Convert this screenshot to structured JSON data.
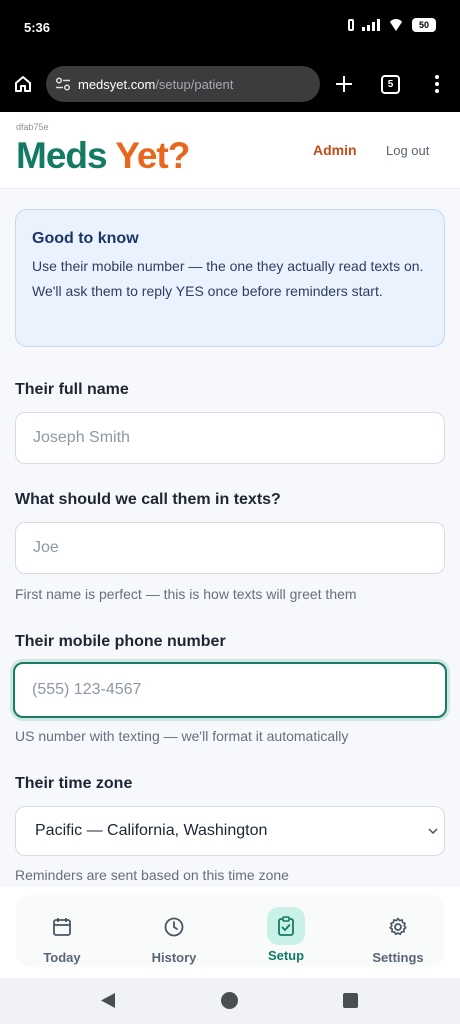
{
  "status_bar": {
    "time": "5:36",
    "battery": "50"
  },
  "browser": {
    "url_host": "medsyet.com",
    "url_path": "/setup/patient",
    "tab_count": "5"
  },
  "header": {
    "build_id": "dfab75e",
    "logo_part1": "Meds ",
    "logo_part2": "Yet?",
    "admin_label": "Admin",
    "logout_label": "Log out"
  },
  "info": {
    "title": "Good to know",
    "body": "Use their mobile number — the one they actually read texts on. We'll ask them to reply YES once before reminders start."
  },
  "form": {
    "full_name": {
      "label": "Their full name",
      "placeholder": "Joseph Smith"
    },
    "nickname": {
      "label": "What should we call them in texts?",
      "placeholder": "Joe",
      "helper": "First name is perfect — this is how texts will greet them"
    },
    "phone": {
      "label": "Their mobile phone number",
      "placeholder": "(555) 123-4567",
      "helper": "US number with texting — we'll format it automatically"
    },
    "timezone": {
      "label": "Their time zone",
      "value": "Pacific — California, Washington",
      "helper": "Reminders are sent based on this time zone"
    }
  },
  "bottom_nav": [
    {
      "label": "Today",
      "icon": "calendar-icon"
    },
    {
      "label": "History",
      "icon": "clock-icon"
    },
    {
      "label": "Setup",
      "icon": "clipboard-check-icon",
      "active": true
    },
    {
      "label": "Settings",
      "icon": "gear-icon"
    }
  ],
  "colors": {
    "brand_green": "#137a64",
    "brand_orange": "#e8671e",
    "admin_orange": "#c44b15",
    "info_bg": "#eaf2fd",
    "focus_ring": "#1a7a68"
  }
}
